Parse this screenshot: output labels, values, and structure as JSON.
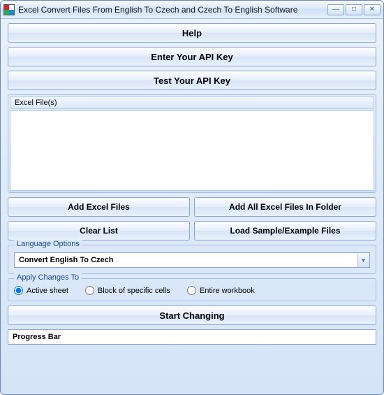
{
  "window": {
    "title": "Excel Convert Files From English To Czech and Czech To English Software"
  },
  "buttons": {
    "help": "Help",
    "enter_api": "Enter Your API Key",
    "test_api": "Test Your API Key",
    "add_files": "Add Excel Files",
    "add_folder": "Add All Excel Files In Folder",
    "clear_list": "Clear List",
    "load_sample": "Load Sample/Example Files",
    "start": "Start Changing"
  },
  "file_panel": {
    "header": "Excel File(s)"
  },
  "language_options": {
    "legend": "Language Options",
    "selected": "Convert English To Czech"
  },
  "apply_changes": {
    "legend": "Apply Changes To",
    "options": {
      "active": "Active sheet",
      "block": "Block of specific cells",
      "entire": "Entire workbook"
    },
    "selected": "active"
  },
  "progress": {
    "label": "Progress Bar"
  }
}
